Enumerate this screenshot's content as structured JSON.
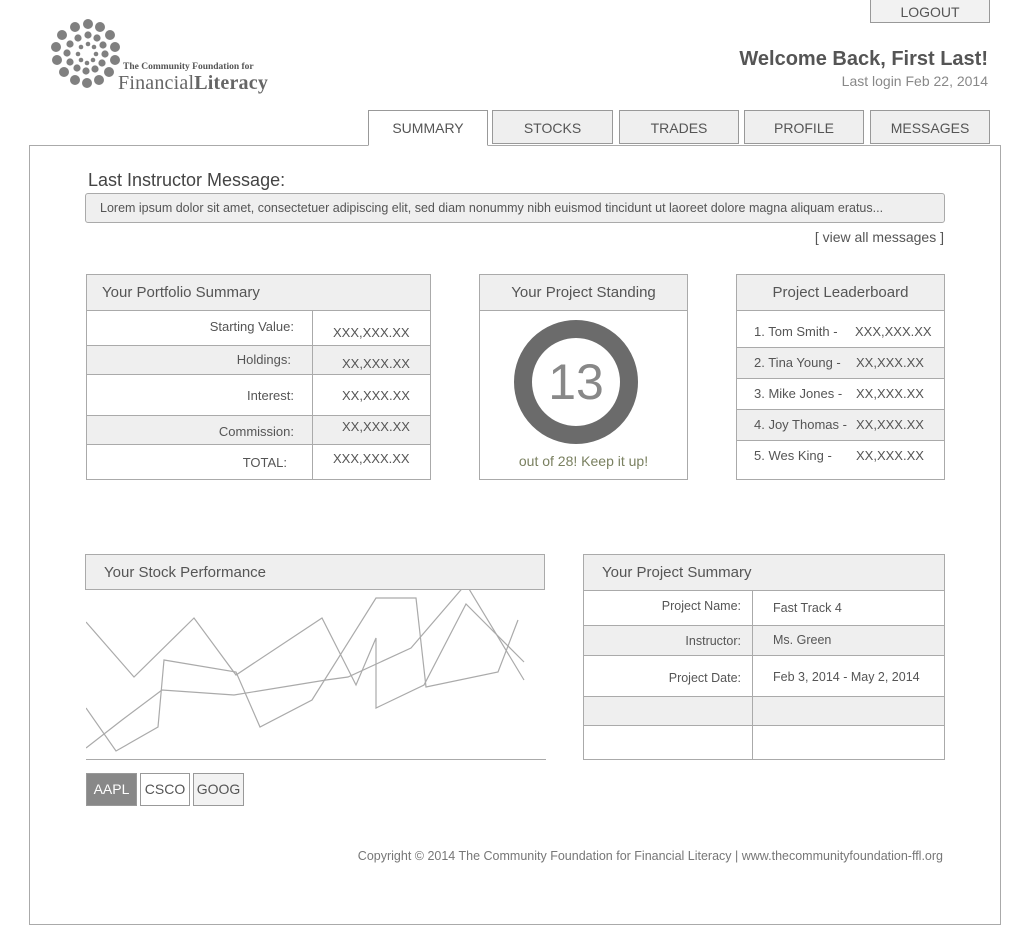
{
  "header": {
    "logout_label": "LOGOUT",
    "logo_small": "The Community Foundation for",
    "logo_big_1": "Financial",
    "logo_big_2": "Literacy",
    "welcome": "Welcome Back, First Last!",
    "last_login": "Last login Feb 22, 2014"
  },
  "tabs": [
    "SUMMARY",
    "STOCKS",
    "TRADES",
    "PROFILE",
    "MESSAGES"
  ],
  "message": {
    "title": "Last Instructor Message:",
    "text": "Lorem ipsum dolor sit amet, consectetuer adipiscing elit, sed diam nonummy nibh euismod tincidunt ut laoreet dolore magna aliquam eratus...",
    "view_all": "[ view all messages ]"
  },
  "portfolio": {
    "title": "Your Portfolio Summary",
    "rows": [
      {
        "label": "Starting Value:",
        "value": "XXX,XXX.XX"
      },
      {
        "label": "Holdings:",
        "value": "XX,XXX.XX"
      },
      {
        "label": "Interest:",
        "value": "XX,XXX.XX"
      },
      {
        "label": "Commission:",
        "value": "XX,XXX.XX"
      },
      {
        "label": "TOTAL:",
        "value": "XXX,XXX.XX"
      }
    ]
  },
  "standing": {
    "title": "Your Project Standing",
    "rank": "13",
    "caption": "out of 28! Keep it up!"
  },
  "leaderboard": {
    "title": "Project Leaderboard",
    "items": [
      {
        "name": "1. Tom Smith -",
        "value": "XXX,XXX.XX"
      },
      {
        "name": "2. Tina Young -",
        "value": "XX,XXX.XX"
      },
      {
        "name": "3. Mike Jones -",
        "value": "XX,XXX.XX"
      },
      {
        "name": "4. Joy Thomas -",
        "value": "XX,XXX.XX"
      },
      {
        "name": "5. Wes King -",
        "value": "XX,XXX.XX"
      }
    ]
  },
  "stock_performance": {
    "title": "Your Stock Performance",
    "buttons": [
      "AAPL",
      "CSCO",
      "GOOG"
    ],
    "active": "AAPL"
  },
  "project_summary": {
    "title": "Your Project Summary",
    "rows": [
      {
        "label": "Project Name:",
        "value": "Fast Track 4"
      },
      {
        "label": "Instructor:",
        "value": "Ms. Green"
      },
      {
        "label": "Project Date:",
        "value": "Feb 3, 2014 - May 2, 2014"
      },
      {
        "label": "",
        "value": ""
      },
      {
        "label": "",
        "value": ""
      }
    ]
  },
  "footer": {
    "text": "Copyright © 2014 The Community Foundation for Financial Literacy | www.thecommunityfoundation-ffl.org"
  },
  "colors": {
    "panel_bg": "#efefef",
    "border": "#aaaaaa",
    "ring": "#6b6b6b",
    "active_button": "#888888"
  }
}
